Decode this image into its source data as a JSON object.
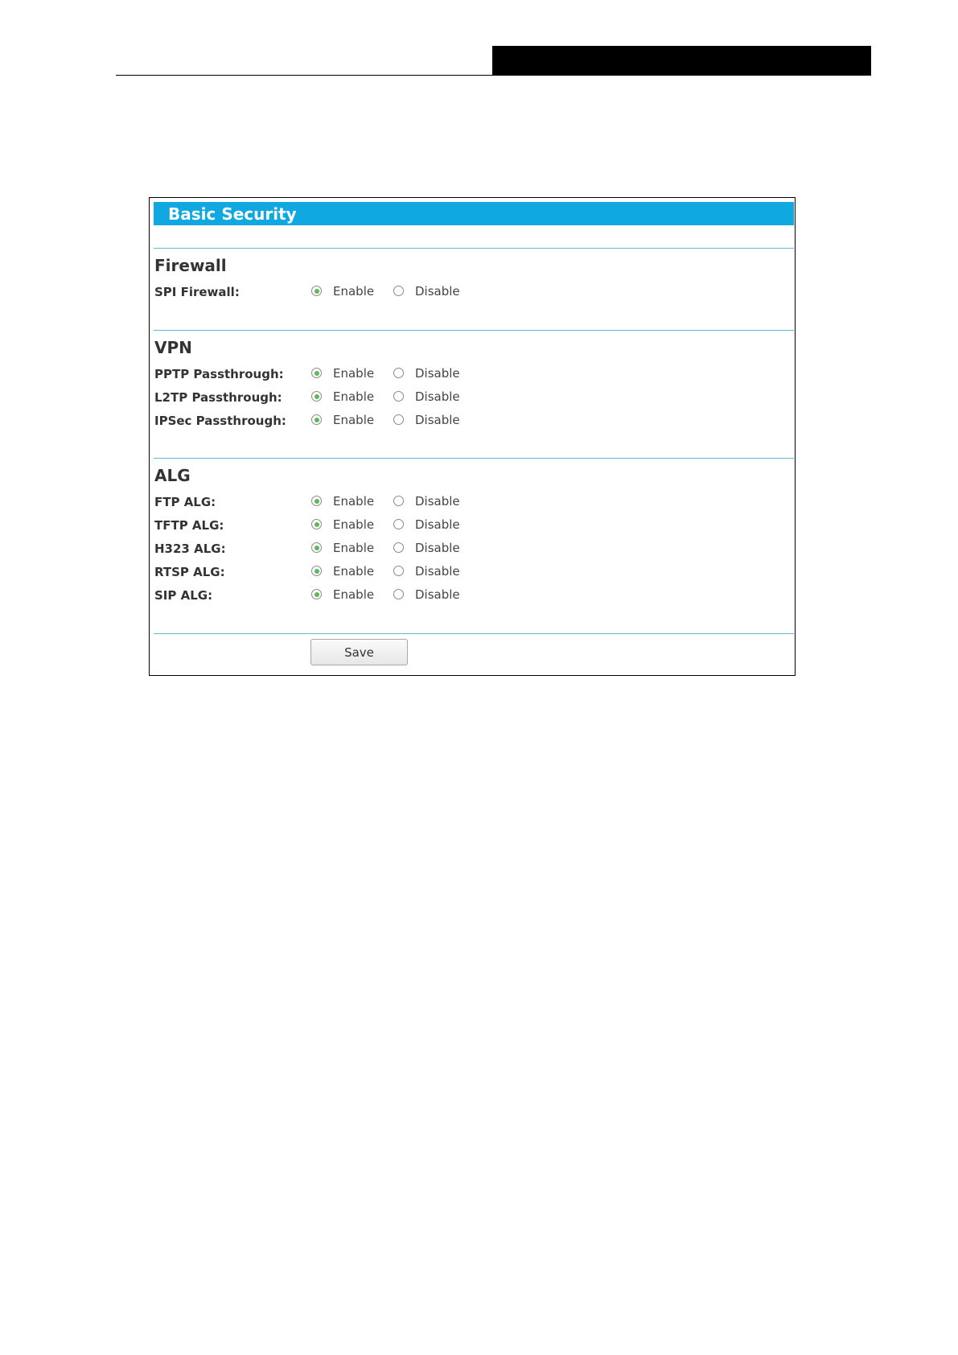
{
  "panel": {
    "title": "Basic Security",
    "save_label": "Save"
  },
  "sections": {
    "firewall": {
      "title": "Firewall",
      "rows": [
        {
          "label": "SPI Firewall:",
          "enable": "Enable",
          "disable": "Disable",
          "selected": "Enable"
        }
      ]
    },
    "vpn": {
      "title": "VPN",
      "rows": [
        {
          "label": "PPTP Passthrough:",
          "enable": "Enable",
          "disable": "Disable",
          "selected": "Enable"
        },
        {
          "label": "L2TP Passthrough:",
          "enable": "Enable",
          "disable": "Disable",
          "selected": "Enable"
        },
        {
          "label": "IPSec Passthrough:",
          "enable": "Enable",
          "disable": "Disable",
          "selected": "Enable"
        }
      ]
    },
    "alg": {
      "title": "ALG",
      "rows": [
        {
          "label": "FTP ALG:",
          "enable": "Enable",
          "disable": "Disable",
          "selected": "Enable"
        },
        {
          "label": "TFTP ALG:",
          "enable": "Enable",
          "disable": "Disable",
          "selected": "Enable"
        },
        {
          "label": "H323 ALG:",
          "enable": "Enable",
          "disable": "Disable",
          "selected": "Enable"
        },
        {
          "label": "RTSP ALG:",
          "enable": "Enable",
          "disable": "Disable",
          "selected": "Enable"
        },
        {
          "label": "SIP ALG:",
          "enable": "Enable",
          "disable": "Disable",
          "selected": "Enable"
        }
      ]
    }
  },
  "colors": {
    "title_bar": "#10a8e0",
    "radio_selected": "#5cb85c",
    "section_rule": "#60b8d6"
  }
}
